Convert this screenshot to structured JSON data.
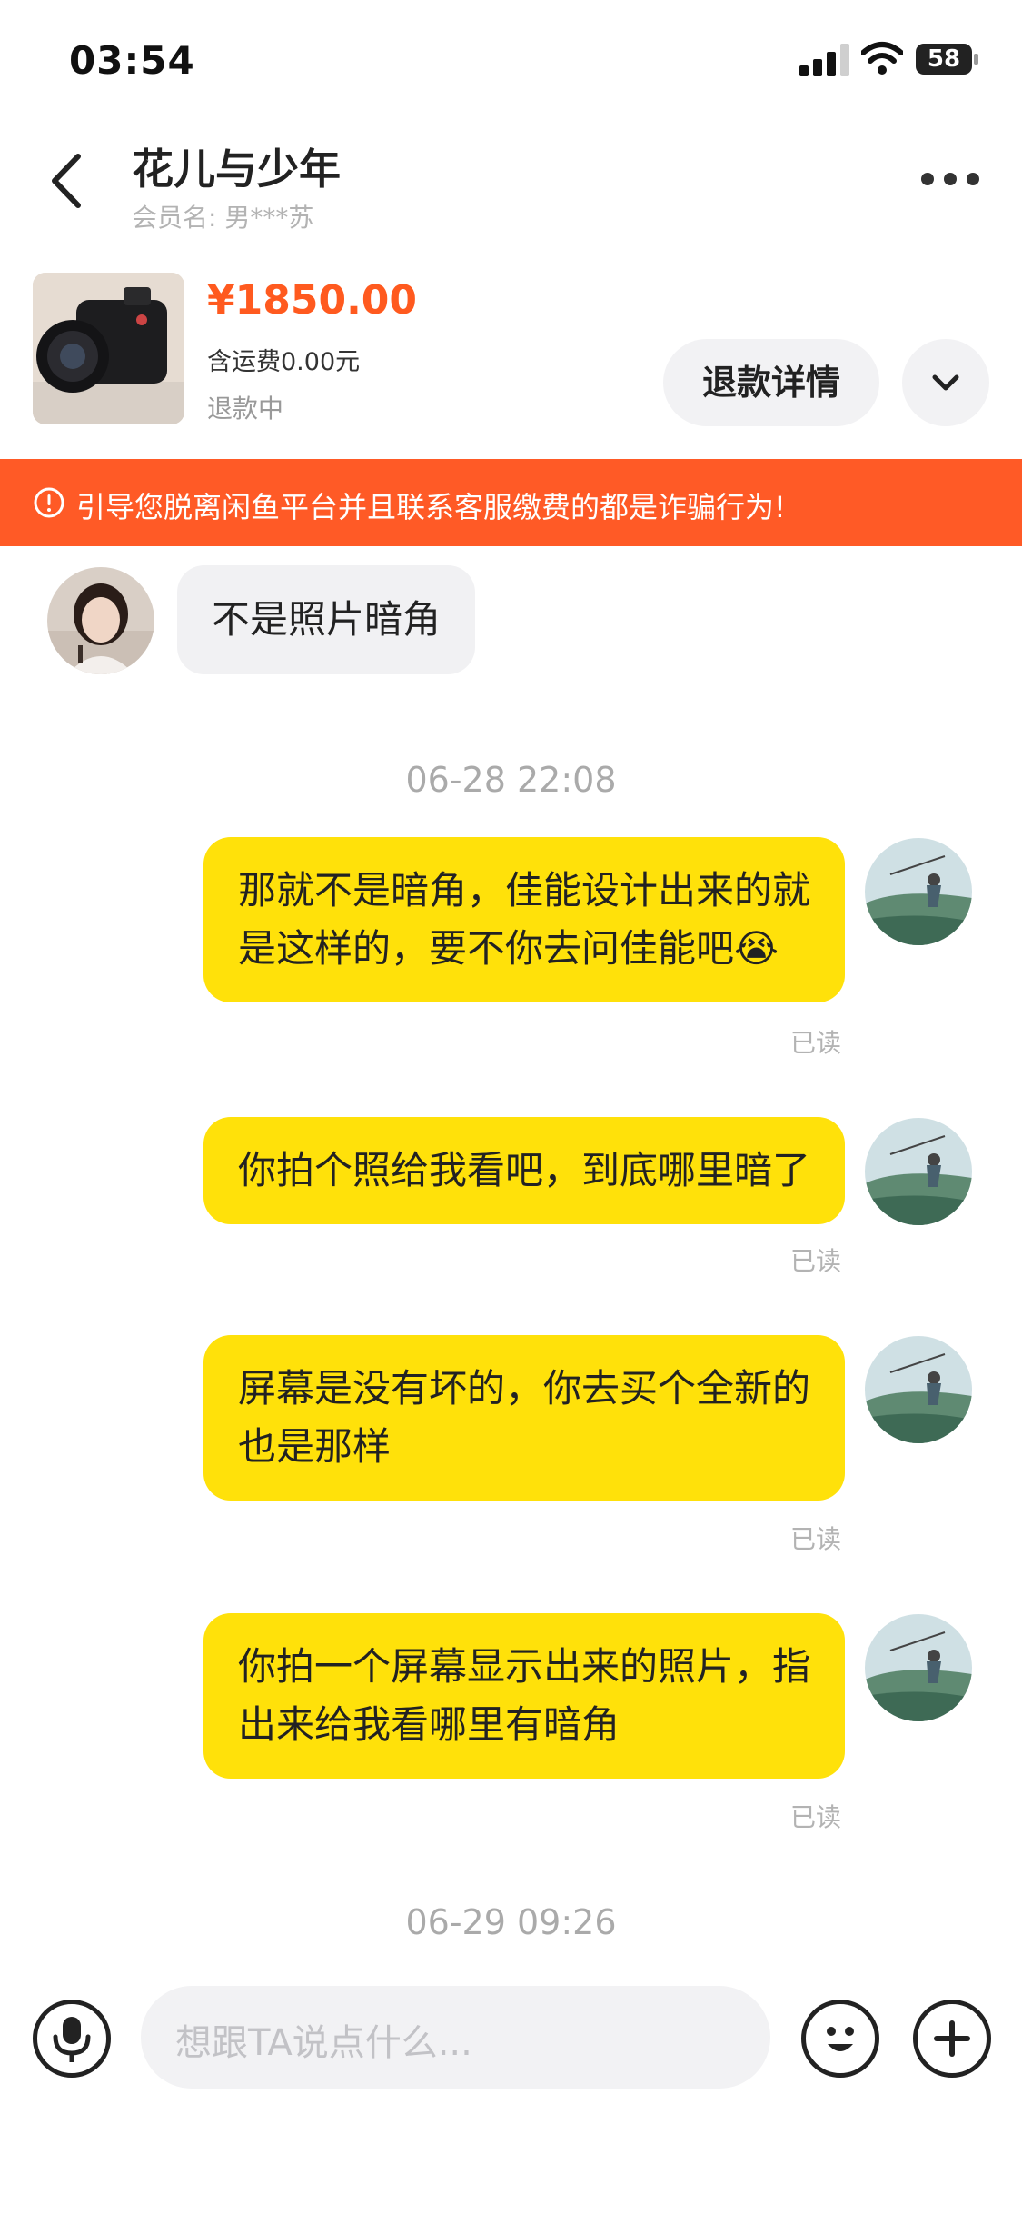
{
  "status_bar": {
    "time": "03:54",
    "battery": "58"
  },
  "header": {
    "title": "花儿与少年",
    "member_label": "会员名: ",
    "member_name": "男***苏"
  },
  "product": {
    "price": "¥1850.00",
    "shipping": "含运费0.00元",
    "status": "退款中",
    "refund_button": "退款详情"
  },
  "warning": {
    "text": "引导您脱离闲鱼平台并且联系客服缴费的都是诈骗行为!"
  },
  "messages": {
    "incoming": {
      "text": "不是照片暗角"
    },
    "time1": "06-28 22:08",
    "m1": {
      "line1": "那就不是暗角，佳能设计出来的就",
      "line2": "是这样的，要不你去问佳能吧",
      "emoji": "😭",
      "status": "已读"
    },
    "m2": {
      "line1": "你拍个照给我看吧，到底哪里暗了",
      "status": "已读"
    },
    "m3": {
      "line1": "屏幕是没有坏的，你去买个全新的",
      "line2": "也是那样",
      "status": "已读"
    },
    "m4": {
      "line1": "你拍一个屏幕显示出来的照片，指",
      "line2": "出来给我看哪里有暗角",
      "status": "已读"
    },
    "time2": "06-29 09:26"
  },
  "input": {
    "placeholder": "想跟TA说点什么..."
  },
  "icons": {
    "back": "chevron-left-icon",
    "more": "more-dots-icon",
    "expand": "chevron-down-icon",
    "warning": "exclamation-circle-icon",
    "mic": "mic-icon",
    "emoji": "smile-icon",
    "plus": "plus-icon"
  },
  "colors": {
    "accent_orange": "#ff5a1f",
    "warning_bg": "#ff5a26",
    "bubble_yellow": "#ffe10a",
    "bubble_grey": "#f1f1f3"
  }
}
